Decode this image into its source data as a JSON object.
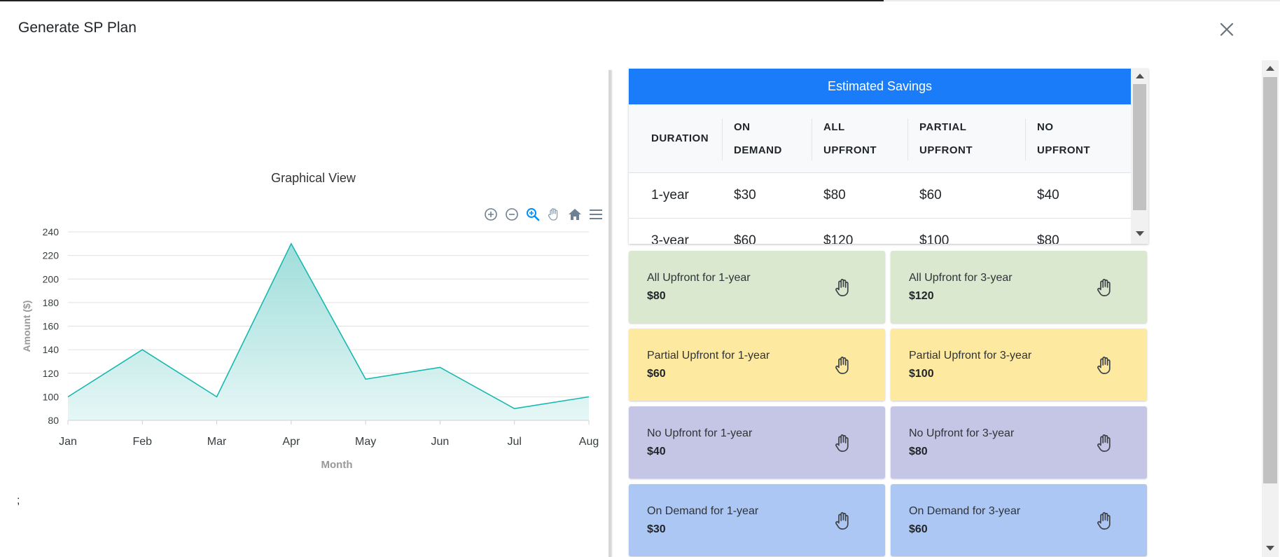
{
  "modal": {
    "title": "Generate SP Plan",
    "close_icon": "close-icon"
  },
  "chart": {
    "title": "Graphical View"
  },
  "chart_data": {
    "type": "area",
    "title": "Graphical View",
    "xlabel": "Month",
    "ylabel": "Amount ($)",
    "categories": [
      "Jan",
      "Feb",
      "Mar",
      "Apr",
      "May",
      "Jun",
      "Jul",
      "Aug"
    ],
    "values": [
      100,
      140,
      100,
      230,
      115,
      125,
      90,
      100
    ],
    "ylim": [
      80,
      240
    ],
    "yticks": [
      80,
      100,
      120,
      140,
      160,
      180,
      200,
      220,
      240
    ],
    "grid": true,
    "colors": {
      "line": "#17b8b0",
      "fill_top": "#8fd8d4",
      "fill_bottom": "#e3f6f5"
    }
  },
  "toolbar": {
    "icons": [
      "zoom-in-icon",
      "zoom-out-icon",
      "zoom-select-icon",
      "pan-hand-icon",
      "home-icon",
      "menu-icon"
    ]
  },
  "footer_text": ";",
  "savings": {
    "header": "Estimated Savings",
    "header_color": "#1a7cf9",
    "columns": [
      {
        "line1": "DURATION",
        "line2": ""
      },
      {
        "line1": "ON",
        "line2": "DEMAND"
      },
      {
        "line1": "ALL",
        "line2": "UPFRONT"
      },
      {
        "line1": "PARTIAL",
        "line2": "UPFRONT"
      },
      {
        "line1": "NO",
        "line2": "UPFRONT"
      }
    ],
    "rows": [
      [
        "1-year",
        "$30",
        "$80",
        "$60",
        "$40"
      ],
      [
        "3-year",
        "$60",
        "$120",
        "$100",
        "$80"
      ]
    ]
  },
  "cards": [
    {
      "label": "All Upfront for 1-year",
      "value": "$80",
      "color": "#d9e8cf",
      "icon": "hand-icon"
    },
    {
      "label": "All Upfront for 3-year",
      "value": "$120",
      "color": "#d9e8cf",
      "icon": "hand-icon"
    },
    {
      "label": "Partial Upfront for 1-year",
      "value": "$60",
      "color": "#fde9a0",
      "icon": "hand-icon"
    },
    {
      "label": "Partial Upfront for 3-year",
      "value": "$100",
      "color": "#fde9a0",
      "icon": "hand-icon"
    },
    {
      "label": "No Upfront for 1-year",
      "value": "$40",
      "color": "#c5c6e6",
      "icon": "hand-icon"
    },
    {
      "label": "No Upfront for 3-year",
      "value": "$80",
      "color": "#c5c6e6",
      "icon": "hand-icon"
    },
    {
      "label": "On Demand for 1-year",
      "value": "$30",
      "color": "#adc7f4",
      "icon": "hand-icon"
    },
    {
      "label": "On Demand for 3-year",
      "value": "$60",
      "color": "#adc7f4",
      "icon": "hand-icon"
    }
  ]
}
